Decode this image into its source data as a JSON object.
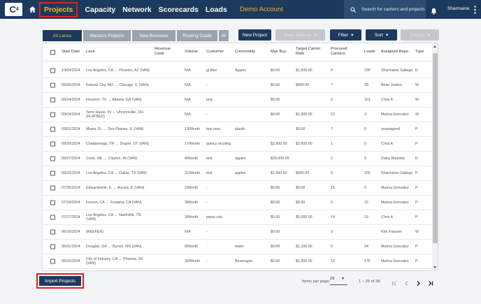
{
  "nav": {
    "logo": "C",
    "logo_sup": "4",
    "links": [
      "Projects",
      "Capacity",
      "Network",
      "Scorecards",
      "Loads"
    ],
    "demo": "Demo Account",
    "search_placeholder": "Search for carriers and projects",
    "user": "Sharmaine"
  },
  "tabs": [
    "All Lanes",
    "Marisa's Projects",
    "New Business",
    "Routing Guide",
    "W"
  ],
  "toolbar": {
    "new_project": "New Project",
    "save_view": "Save View as",
    "filter": "Filter",
    "sort": "Sort",
    "actions": "Actions"
  },
  "table": {
    "headers": [
      "Start Date",
      "Lane",
      "Revenue Code",
      "Volume",
      "Customer",
      "Commodity",
      "Max Buy",
      "Target Carrier Rate",
      "Procured Carriers",
      "Loads",
      "Assigned Reps",
      "Type"
    ],
    "rows": [
      [
        "10/04/2024",
        "Los Angeles, CA → Phoenix, AZ (VAN)",
        "",
        "N/A",
        "gl tiles",
        "Apples",
        "$0.00",
        "$1,500.00",
        "4",
        "290",
        "Sharmaine Gallego",
        "D"
      ],
      [
        "09/26/2024",
        "Kansas City, MO → Chicago, IL (VAN)",
        "",
        "N/A",
        "-",
        "",
        "$0.00",
        "$800.00",
        "7",
        "39",
        "Brian Justice",
        "W"
      ],
      [
        "09/24/2024",
        "Houston, TX → Atlanta, GA (VAN)",
        "",
        "N/A",
        "png",
        "",
        "$0.00",
        "",
        "0",
        "101",
        "Chris A",
        "W"
      ],
      [
        "09/04/2024",
        "Terre Haute, IN → Uhrichsville, OH (FLATBED)",
        "",
        "N/A",
        "-",
        "",
        "$0.00",
        "$1,500.00",
        "22",
        "3",
        "Marisa Gonzalez",
        "W"
      ],
      [
        "09/01/2024",
        "Miami, FL → Des Plaines, IL (VAN)",
        "",
        "13/Month",
        "test new",
        "plastic",
        "",
        "$0.00",
        "7",
        "0",
        "unassigned",
        "P"
      ],
      [
        "09/29/2024",
        "Chattanooga, TN → Draper, UT (VAN)",
        "",
        "17/Month",
        "quincy recyling",
        "",
        "$2,900.00",
        "$2,600.00",
        "1",
        "0",
        "Chris A",
        "P"
      ],
      [
        "09/27/2024",
        "Crete, NE → Clayton, IN (VAN)",
        "",
        "4/Month",
        "test",
        "apples",
        "$25,000.00",
        "",
        "2",
        "0",
        "Daisy Bautista",
        "D"
      ],
      [
        "09/23/2024",
        "Los Angeles, CA → Dallas, TX (VAN)",
        "",
        "22/Month",
        "test",
        "apples",
        "$1,500.00",
        "$900.00",
        "6",
        "155",
        "Sharmaine Gallego",
        "P"
      ],
      [
        "07/25/2024",
        "Edwardsville, IL → Aurora, IL (VAN)",
        "",
        "2/Month",
        "-",
        "",
        "$0.00",
        "$0.00",
        "15",
        "0",
        "Marisa Gonzalez",
        "P"
      ],
      [
        "07/19/2024",
        "Fresno, CA → Fontana, CA (VAN)",
        "",
        "3/Month",
        "-",
        "",
        "$0.00",
        "$0.00",
        "9",
        "15",
        "Marisa Gonzalez",
        "P"
      ],
      [
        "07/17/2024",
        "Los Angeles, CA → Nashville, TN (VAN)",
        "",
        "3/Month",
        "pepsi cab",
        "",
        "$0.00",
        "$5,000.00",
        "14",
        "19",
        "Chris A",
        "P"
      ],
      [
        "06/19/2024",
        "(REEFER)",
        "",
        "N/A",
        "-",
        "",
        "$0.00",
        "",
        "3",
        "",
        "Kirk Franzen",
        "W"
      ],
      [
        "06/01/2024",
        "Douglas, GA → Byram, MS (VAN)",
        "",
        "9/Month",
        "-",
        "water",
        "$0.00",
        "$1,100.00",
        "6",
        "34",
        "Marisa Gonzalez",
        "P"
      ],
      [
        "05/15/2024",
        "City of Industry, CA → Phoenix, AZ (VAN)",
        "",
        "30/Month",
        "-",
        "Beverages",
        "$0.00",
        "$1,000.00",
        "10",
        "176",
        "Marisa Gonzalez",
        "P"
      ]
    ]
  },
  "footer": {
    "import": "Import Projects",
    "items_per_page_label": "Items per page:",
    "items_per_page": "25",
    "range": "1 – 25 of 38"
  }
}
